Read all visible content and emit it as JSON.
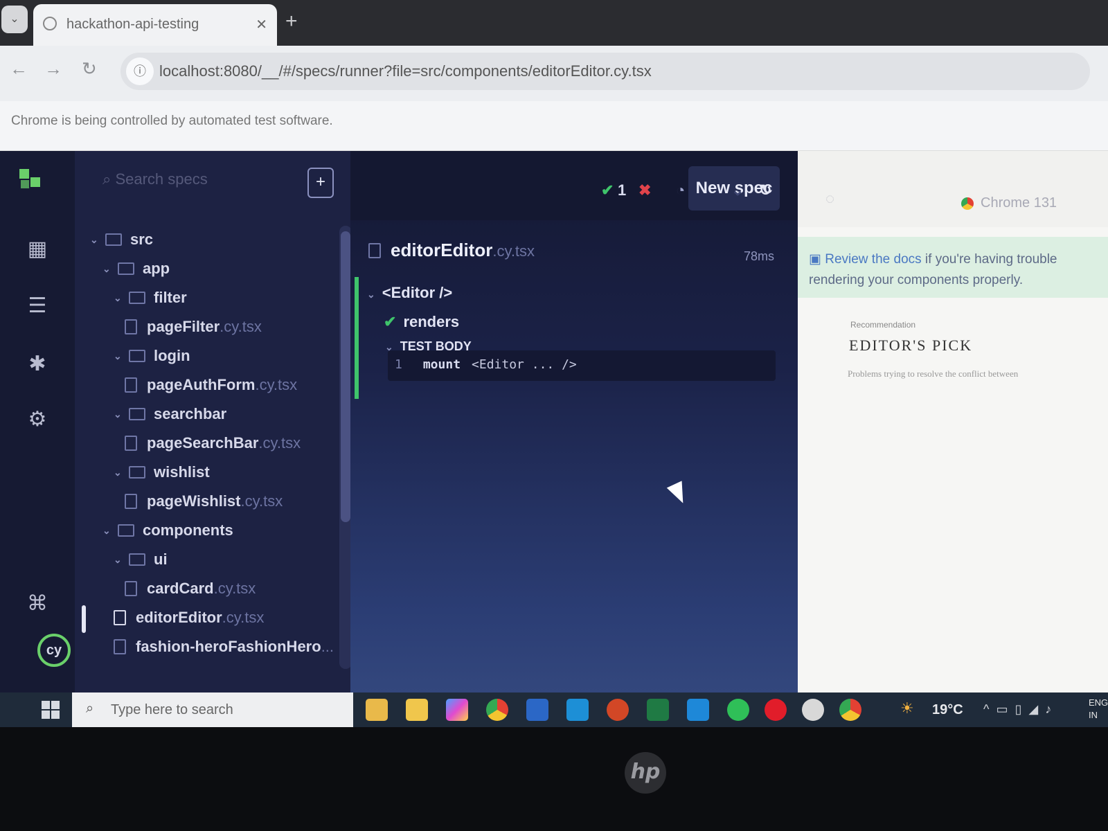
{
  "browser": {
    "tab_title": "hackathon-api-testing",
    "url": "localhost:8080/__/#/specs/runner?file=src/components/editorEditor.cy.tsx",
    "infobar": "Chrome is being controlled by automated test software."
  },
  "cypress": {
    "search_placeholder": "Search specs",
    "new_spec_label": "New spec",
    "passed_count": "1",
    "tree": [
      {
        "kind": "folder",
        "name": "src",
        "ext": "",
        "depth": 0
      },
      {
        "kind": "folder",
        "name": "app",
        "ext": "",
        "depth": 1
      },
      {
        "kind": "folder",
        "name": "filter",
        "ext": "",
        "depth": 2
      },
      {
        "kind": "file",
        "name": "pageFilter",
        "ext": ".cy.tsx",
        "depth": 3
      },
      {
        "kind": "folder",
        "name": "login",
        "ext": "",
        "depth": 2
      },
      {
        "kind": "file",
        "name": "pageAuthForm",
        "ext": ".cy.tsx",
        "depth": 3
      },
      {
        "kind": "folder",
        "name": "searchbar",
        "ext": "",
        "depth": 2
      },
      {
        "kind": "file",
        "name": "pageSearchBar",
        "ext": ".cy.tsx",
        "depth": 3
      },
      {
        "kind": "folder",
        "name": "wishlist",
        "ext": "",
        "depth": 2
      },
      {
        "kind": "file",
        "name": "pageWishlist",
        "ext": ".cy.tsx",
        "depth": 3
      },
      {
        "kind": "folder",
        "name": "components",
        "ext": "",
        "depth": 1
      },
      {
        "kind": "folder",
        "name": "ui",
        "ext": "",
        "depth": 2
      },
      {
        "kind": "file",
        "name": "cardCard",
        "ext": ".cy.tsx",
        "depth": 3
      },
      {
        "kind": "file",
        "name": "editorEditor",
        "ext": ".cy.tsx",
        "depth": 2,
        "active": true
      },
      {
        "kind": "file",
        "name": "fashion-heroFashionHero",
        "ext": "...",
        "depth": 2
      }
    ],
    "reporter": {
      "spec_name": "editorEditor",
      "spec_ext": ".cy.tsx",
      "duration": "78ms",
      "suite": "<Editor />",
      "test": "renders",
      "test_body_label": "TEST BODY",
      "cmd_index": "1",
      "cmd_name": "mount",
      "cmd_arg": "<Editor ... />"
    },
    "aut": {
      "browser_label": "Chrome 131",
      "notice_link": "Review the docs",
      "notice_text": " if you're having trouble rendering your components properly.",
      "pick_small": "Recommendation",
      "pick_title": "EDITOR'S PICK",
      "pick_text": "Problems trying to resolve the conflict between"
    }
  },
  "taskbar": {
    "search_placeholder": "Type here to search",
    "temperature": "19°C",
    "lang_1": "ENG",
    "lang_2": "IN"
  },
  "colors": {
    "cypress_green": "#6ad06a",
    "reporter_bg": "#1b2248",
    "pass": "#3fc46b",
    "fail": "#e0434b"
  }
}
